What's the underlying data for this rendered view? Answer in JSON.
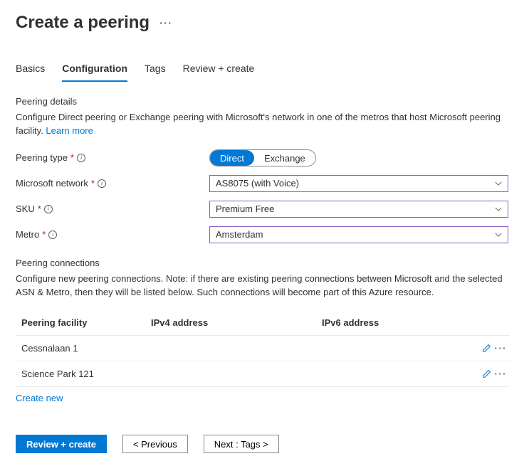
{
  "header": {
    "title": "Create a peering"
  },
  "tabs": [
    {
      "label": "Basics",
      "active": false
    },
    {
      "label": "Configuration",
      "active": true
    },
    {
      "label": "Tags",
      "active": false
    },
    {
      "label": "Review + create",
      "active": false
    }
  ],
  "peering_details": {
    "heading": "Peering details",
    "description": "Configure Direct peering or Exchange peering with Microsoft's network in one of the metros that host Microsoft peering facility. ",
    "learn_more": "Learn more"
  },
  "fields": {
    "peering_type": {
      "label": "Peering type",
      "options": [
        "Direct",
        "Exchange"
      ],
      "selected": "Direct"
    },
    "microsoft_network": {
      "label": "Microsoft network",
      "value": "AS8075 (with Voice)"
    },
    "sku": {
      "label": "SKU",
      "value": "Premium Free"
    },
    "metro": {
      "label": "Metro",
      "value": "Amsterdam"
    }
  },
  "connections": {
    "heading": "Peering connections",
    "description": "Configure new peering connections. Note: if there are existing peering connections between Microsoft and the selected ASN & Metro, then they will be listed below. Such connections will become part of this Azure resource.",
    "columns": {
      "facility": "Peering facility",
      "ipv4": "IPv4 address",
      "ipv6": "IPv6 address"
    },
    "rows": [
      {
        "facility": "Cessnalaan 1",
        "ipv4": "",
        "ipv6": ""
      },
      {
        "facility": "Science Park 121",
        "ipv4": "",
        "ipv6": ""
      }
    ],
    "create_new": "Create new"
  },
  "footer": {
    "review": "Review + create",
    "previous": "< Previous",
    "next": "Next : Tags >"
  }
}
